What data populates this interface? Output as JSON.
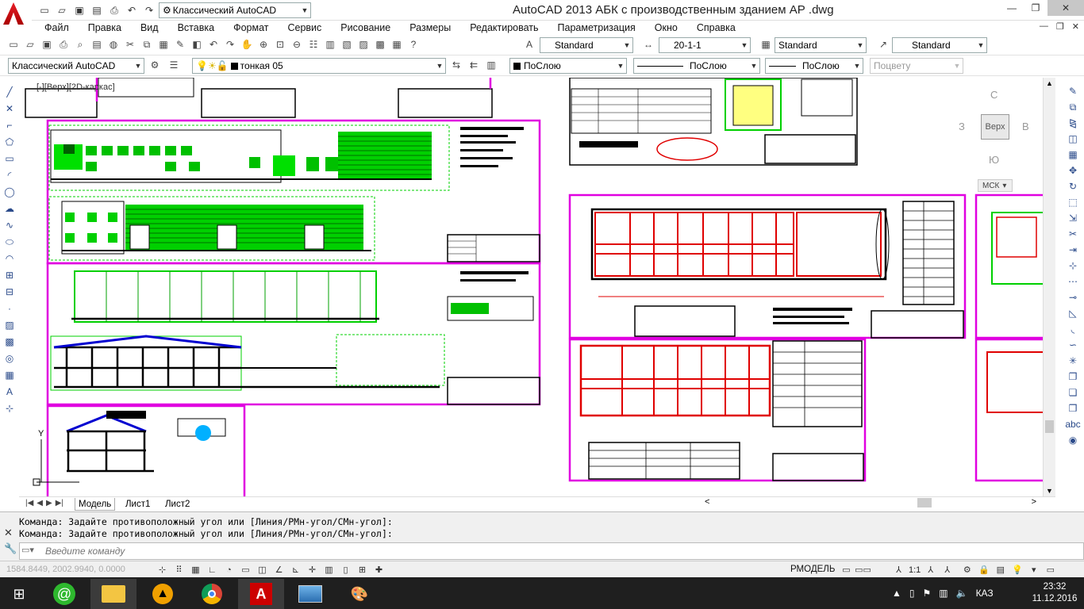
{
  "window": {
    "title": "AutoCAD 2013    АБК с производственным зданием АР .dwg",
    "workspace": "Классический AutoCAD"
  },
  "menu": [
    "Файл",
    "Правка",
    "Вид",
    "Вставка",
    "Формат",
    "Сервис",
    "Рисование",
    "Размеры",
    "Редактировать",
    "Параметризация",
    "Окно",
    "Справка"
  ],
  "styles": {
    "text_style": "Standard",
    "dim_style": "20-1-1",
    "table_style": "Standard",
    "multileader_style": "Standard"
  },
  "layers": {
    "workspace": "Классический AutoCAD",
    "current_layer": "тонкая 05",
    "color": "ПоСлою",
    "linetype": "ПоСлою",
    "lineweight": "ПоСлою",
    "plot_style": "Поцвету"
  },
  "viewport": {
    "label": "[-][Верх][2D-каркас]",
    "viewcube": {
      "top": "Верх",
      "north": "С",
      "south": "Ю",
      "west": "З",
      "east": "В"
    },
    "ucs": "МСК"
  },
  "layout_tabs": [
    "Модель",
    "Лист1",
    "Лист2"
  ],
  "command": {
    "history": [
      "Команда: Задайте противоположный угол или [Линия/РМн-угол/СМн-угол]:",
      "Команда: Задайте противоположный угол или [Линия/РМн-угол/СМн-угол]:"
    ],
    "placeholder": "Введите команду"
  },
  "status": {
    "coords": "1584.8449, 2002.9940, 0.0000",
    "space": "РМОДЕЛЬ",
    "annotation_scale": "1:1"
  },
  "taskbar": {
    "tray_lang": "КАЗ",
    "time": "23:32",
    "date": "11.12.2016"
  },
  "colors": {
    "frame": "#e000e0",
    "green": "#00d000",
    "red": "#e00000",
    "blue": "#0000d0"
  },
  "icons": {
    "save": "save-icon",
    "print": "print-icon",
    "undo": "undo-icon",
    "redo": "redo-icon",
    "close": "close-icon"
  }
}
